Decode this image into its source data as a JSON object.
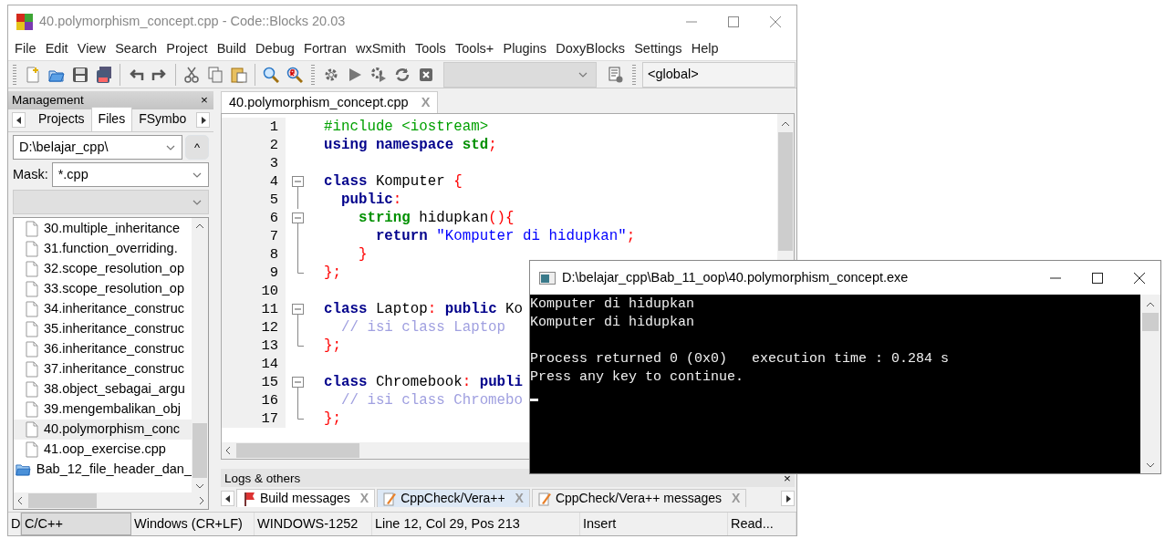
{
  "main_window": {
    "title": "40.polymorphism_concept.cpp - Code::Blocks 20.03"
  },
  "menu": [
    "File",
    "Edit",
    "View",
    "Search",
    "Project",
    "Build",
    "Debug",
    "Fortran",
    "wxSmith",
    "Tools",
    "Tools+",
    "Plugins",
    "DoxyBlocks",
    "Settings",
    "Help"
  ],
  "toolbar": {
    "target_combo": {
      "disabled": true
    },
    "scope_combo": {
      "value": "<global>"
    }
  },
  "management": {
    "title": "Management",
    "close": "×",
    "tabs": [
      {
        "label": "Projects",
        "selected": false
      },
      {
        "label": "Files",
        "selected": true
      },
      {
        "label": "FSymbo",
        "selected": false
      }
    ],
    "path": "D:\\belajar_cpp\\",
    "up_button": "^",
    "mask_label": "Mask:",
    "mask": "*.cpp",
    "files": [
      {
        "kind": "file",
        "label": "30.multiple_inheritance",
        "selected": false
      },
      {
        "kind": "file",
        "label": "31.function_overriding.",
        "selected": false
      },
      {
        "kind": "file",
        "label": "32.scope_resolution_op",
        "selected": false
      },
      {
        "kind": "file",
        "label": "33.scope_resolution_op",
        "selected": false
      },
      {
        "kind": "file",
        "label": "34.inheritance_construc",
        "selected": false
      },
      {
        "kind": "file",
        "label": "35.inheritance_construc",
        "selected": false
      },
      {
        "kind": "file",
        "label": "36.inheritance_construc",
        "selected": false
      },
      {
        "kind": "file",
        "label": "37.inheritance_construc",
        "selected": false
      },
      {
        "kind": "file",
        "label": "38.object_sebagai_argu",
        "selected": false
      },
      {
        "kind": "file",
        "label": "39.mengembalikan_obj",
        "selected": false
      },
      {
        "kind": "file",
        "label": "40.polymorphism_conc",
        "selected": true
      },
      {
        "kind": "file",
        "label": "41.oop_exercise.cpp",
        "selected": false
      },
      {
        "kind": "folder",
        "label": "Bab_12_file_header_dan_",
        "selected": false
      }
    ]
  },
  "editor": {
    "tabs": [
      {
        "label": "40.polymorphism_concept.cpp",
        "close": "X",
        "selected": true
      }
    ],
    "lines": [
      {
        "number": "1",
        "tokens": [
          {
            "kind": "pp",
            "text": "#include <iostream>"
          }
        ]
      },
      {
        "number": "2",
        "tokens": [
          {
            "kind": "kw",
            "text": "using"
          },
          {
            "kind": "kw",
            "text": " namespace"
          },
          {
            "kind": "type",
            "text": " std"
          },
          {
            "kind": "op",
            "text": ";"
          }
        ]
      },
      {
        "number": "3"
      },
      {
        "number": "4",
        "fold": {
          "kind": "open"
        },
        "tokens": [
          {
            "kind": "kw",
            "text": "class"
          },
          {
            "kind": "plain",
            "text": " Komputer"
          },
          {
            "kind": "op",
            "text": " {"
          }
        ]
      },
      {
        "number": "5",
        "fold": {
          "kind": "inner"
        },
        "tokens": [
          {
            "kind": "kw",
            "text": "  public"
          },
          {
            "kind": "op",
            "text": ":"
          }
        ]
      },
      {
        "number": "6",
        "fold": {
          "kind": "open"
        },
        "tokens": [
          {
            "kind": "type",
            "text": "    string"
          },
          {
            "kind": "plain",
            "text": " hidupkan"
          },
          {
            "kind": "op",
            "text": "(){"
          }
        ]
      },
      {
        "number": "7",
        "fold": {
          "kind": "inner"
        },
        "tokens": [
          {
            "kind": "kw",
            "text": "      return"
          },
          {
            "kind": "str",
            "text": " \"Komputer di hidupkan\""
          },
          {
            "kind": "op",
            "text": ";"
          }
        ]
      },
      {
        "number": "8",
        "fold": {
          "kind": "inner"
        },
        "tokens": [
          {
            "kind": "op",
            "text": "    }"
          }
        ]
      },
      {
        "number": "9",
        "fold": {
          "kind": "close"
        },
        "tokens": [
          {
            "kind": "op",
            "text": "};"
          }
        ]
      },
      {
        "number": "10"
      },
      {
        "number": "11",
        "fold": {
          "kind": "open"
        },
        "tokens": [
          {
            "kind": "kw",
            "text": "class"
          },
          {
            "kind": "plain",
            "text": " Laptop"
          },
          {
            "kind": "op",
            "text": ":"
          },
          {
            "kind": "kw",
            "text": " public"
          },
          {
            "kind": "plain",
            "text": " Ko"
          }
        ]
      },
      {
        "number": "12",
        "fold": {
          "kind": "inner"
        },
        "tokens": [
          {
            "kind": "cmt",
            "text": "  // isi class Laptop"
          }
        ]
      },
      {
        "number": "13",
        "fold": {
          "kind": "close"
        },
        "tokens": [
          {
            "kind": "op",
            "text": "};"
          }
        ]
      },
      {
        "number": "14"
      },
      {
        "number": "15",
        "fold": {
          "kind": "open"
        },
        "tokens": [
          {
            "kind": "kw",
            "text": "class"
          },
          {
            "kind": "plain",
            "text": " Chromebook"
          },
          {
            "kind": "op",
            "text": ":"
          },
          {
            "kind": "kw",
            "text": " publi"
          }
        ]
      },
      {
        "number": "16",
        "fold": {
          "kind": "inner"
        },
        "tokens": [
          {
            "kind": "cmt",
            "text": "  // isi class Chromebo"
          }
        ]
      },
      {
        "number": "17",
        "fold": {
          "kind": "close"
        },
        "tokens": [
          {
            "kind": "op",
            "text": "};"
          }
        ]
      }
    ]
  },
  "logs": {
    "title": "Logs & others",
    "close": "×",
    "tabs": [
      {
        "label": "Build messages",
        "close": "X",
        "selected": true
      },
      {
        "label": "CppCheck/Vera++",
        "close": "X",
        "selected": false
      },
      {
        "label": "CppCheck/Vera++ messages",
        "close": "X",
        "selected": false
      }
    ]
  },
  "status_bar": [
    "D",
    "C/C++",
    "Windows (CR+LF)",
    "WINDOWS-1252",
    "Line 12, Col 29, Pos 213",
    "Insert",
    "Read..."
  ],
  "console": {
    "title": "D:\\belajar_cpp\\Bab_11_oop\\40.polymorphism_concept.exe",
    "lines": [
      "Komputer di hidupkan",
      "Komputer di hidupkan"
    ],
    "footer": [
      "Process returned 0 (0x0)   execution time : 0.284 s",
      "Press any key to continue."
    ]
  }
}
